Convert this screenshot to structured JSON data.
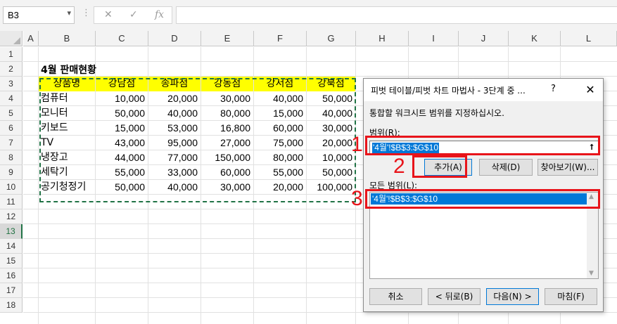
{
  "formula_bar": {
    "name_box": "B3",
    "dots": "⋮",
    "cancel_glyph": "✕",
    "enter_glyph": "✓",
    "fx_label": "fx",
    "formula": ""
  },
  "columns": [
    "A",
    "B",
    "C",
    "D",
    "E",
    "F",
    "G",
    "H",
    "I",
    "J",
    "K",
    "L"
  ],
  "rows": [
    "1",
    "2",
    "3",
    "4",
    "5",
    "6",
    "7",
    "8",
    "9",
    "10",
    "11",
    "12",
    "13",
    "14",
    "15",
    "16",
    "17",
    "18"
  ],
  "active_row": "13",
  "sheet": {
    "title": "4월 판매현황",
    "headers": [
      "상품명",
      "강남점",
      "송파점",
      "강동점",
      "강서점",
      "강북점"
    ],
    "data": [
      [
        "컴퓨터",
        "10,000",
        "20,000",
        "30,000",
        "40,000",
        "50,000"
      ],
      [
        "모니터",
        "50,000",
        "40,000",
        "80,000",
        "15,000",
        "40,000"
      ],
      [
        "키보드",
        "15,000",
        "53,000",
        "16,800",
        "60,000",
        "30,000"
      ],
      [
        "TV",
        "43,000",
        "95,000",
        "27,000",
        "75,000",
        "20,000"
      ],
      [
        "냉장고",
        "44,000",
        "77,000",
        "150,000",
        "80,000",
        "10,000"
      ],
      [
        "세탁기",
        "55,000",
        "33,000",
        "60,000",
        "55,000",
        "50,000"
      ],
      [
        "공기청정기",
        "50,000",
        "40,000",
        "30,000",
        "20,000",
        "100,000"
      ]
    ]
  },
  "dialog": {
    "title": "피벗 테이블/피벗 차트 마법사 - 3단계 중 ...",
    "help": "?",
    "close": "✕",
    "instruction": "통합할 워크시트 범위를 지정하십시오.",
    "range_label": "범위(R):",
    "range_value": "'4월'!$B$3:$G$10",
    "collapse_glyph": "⭡",
    "add_button": "추가(A)",
    "delete_button": "삭제(D)",
    "browse_button": "찾아보기(W)...",
    "all_ranges_label": "모든 범위(L):",
    "all_ranges": [
      "'4월'!$B$3:$G$10"
    ],
    "scroll_up": "▲",
    "scroll_down": "▼",
    "cancel_button": "취소",
    "back_button": "< 뒤로(B)",
    "next_button": "다음(N) >",
    "finish_button": "마침(F)"
  },
  "annotations": {
    "colors": {
      "marker": "#e8141a",
      "accent": "#217346",
      "header_fill": "#ffff00",
      "selection": "#0078d7"
    },
    "labels": [
      "1",
      "2",
      "3"
    ]
  }
}
